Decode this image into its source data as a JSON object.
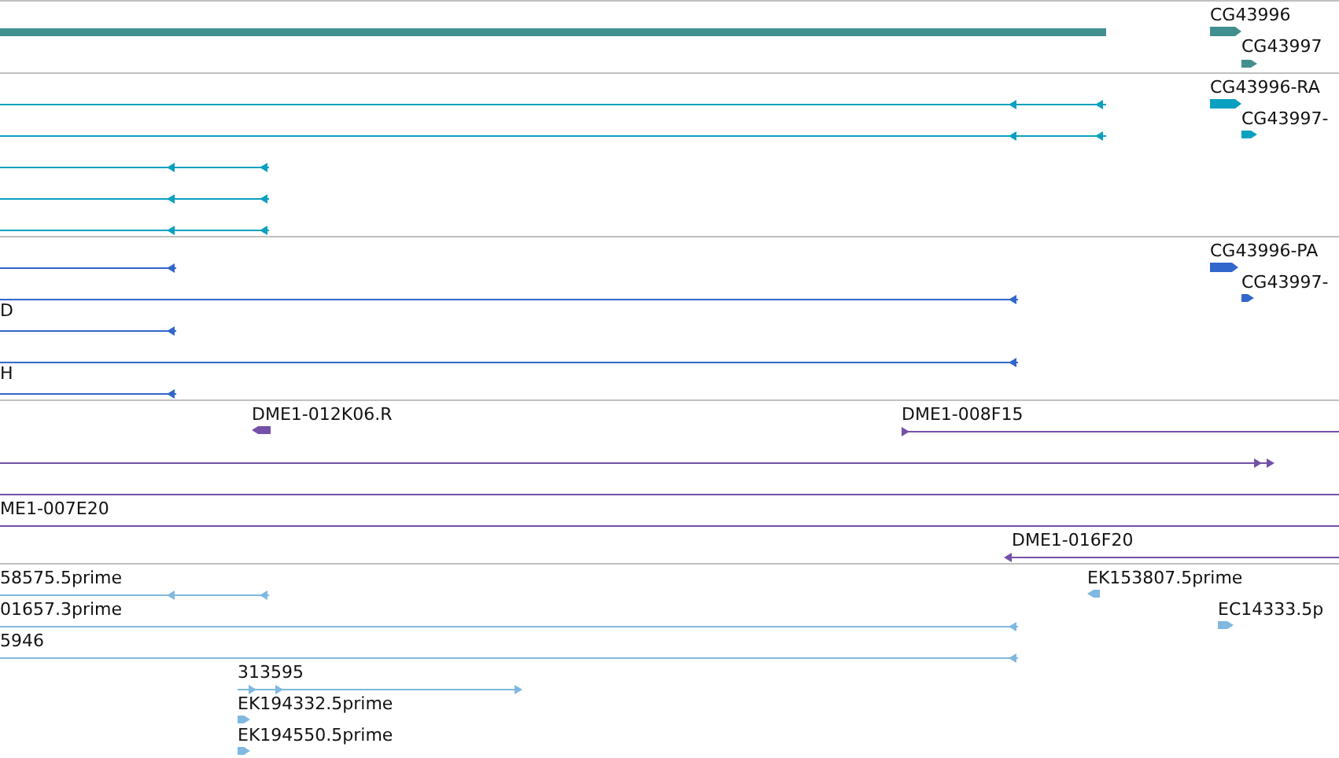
{
  "tracks": [
    {
      "color": "#428f8f",
      "labels": [
        "CG43996",
        "CG43997"
      ]
    },
    {
      "color": "#0aa0c0",
      "labels": [
        "CG43996-RA",
        "CG43997-"
      ]
    },
    {
      "color": "#3366cc",
      "labels": [
        "CG43996-PA",
        "CG43997-",
        "D",
        "H"
      ]
    },
    {
      "color": "#7451a8",
      "labels": [
        "DME1-012K06.R",
        "DME1-008F15",
        "ME1-007E20",
        "DME1-016F20"
      ]
    },
    {
      "color": "#7fb8e0",
      "labels": [
        "58575.5prime",
        "EK153807.5prime",
        "01657.3prime",
        "EC14333.5p",
        "5946",
        "313595",
        "EK194332.5prime",
        "EK194550.5prime"
      ]
    }
  ]
}
